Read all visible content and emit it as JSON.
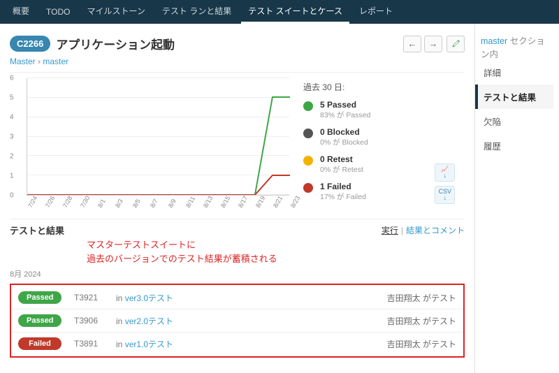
{
  "nav": {
    "tabs": [
      "概要",
      "TODO",
      "マイルストーン",
      "テスト ランと結果",
      "テスト スイートとケース",
      "レポート"
    ],
    "active": 4
  },
  "header": {
    "case_id": "C2266",
    "title": "アプリケーション起動"
  },
  "breadcrumb": {
    "a": "Master",
    "sep": "›",
    "b": "master"
  },
  "sidebar": {
    "master": "master",
    "master_suffix": "セクション内",
    "items": [
      "詳細",
      "テストと結果",
      "欠陥",
      "履歴"
    ],
    "active": 1
  },
  "chart_data": {
    "type": "line",
    "title": "過去 30 日:",
    "ylim": [
      0,
      6
    ],
    "yticks": [
      0,
      1,
      2,
      3,
      4,
      5,
      6
    ],
    "x": [
      "7/24",
      "7/26",
      "7/28",
      "7/30",
      "8/1",
      "8/3",
      "8/5",
      "8/7",
      "8/9",
      "8/11",
      "8/13",
      "8/15",
      "8/17",
      "8/19",
      "8/21",
      "8/23"
    ],
    "series": [
      {
        "name": "Passed",
        "color": "#3fa648",
        "values": [
          0,
          0,
          0,
          0,
          0,
          0,
          0,
          0,
          0,
          0,
          0,
          0,
          0,
          0,
          5,
          5
        ]
      },
      {
        "name": "Failed",
        "color": "#c0392b",
        "values": [
          0,
          0,
          0,
          0,
          0,
          0,
          0,
          0,
          0,
          0,
          0,
          0,
          0,
          0,
          1,
          1
        ]
      }
    ],
    "legend": [
      {
        "label": "5 Passed",
        "sub": "83% が Passed",
        "color": "#3fa648"
      },
      {
        "label": "0 Blocked",
        "sub": "0% が Blocked",
        "color": "#555"
      },
      {
        "label": "0 Retest",
        "sub": "0% が Retest",
        "color": "#f2b300"
      },
      {
        "label": "1 Failed",
        "sub": "17% が Failed",
        "color": "#c0392b"
      }
    ]
  },
  "stat_buttons": {
    "img": "📈",
    "csv": "CSV"
  },
  "section": {
    "title": "テストと結果",
    "run": "実行",
    "results_comments": "結果とコメント"
  },
  "annotation": {
    "l1": "マスターテストスイートに",
    "l2": "過去のバージョンでのテスト結果が蓄積される"
  },
  "month": "8月 2024",
  "results": [
    {
      "status": "Passed",
      "status_class": "pass",
      "tid": "T3921",
      "in": "in ",
      "run": "ver3.0テスト",
      "tester": "吉田翔太 がテスト"
    },
    {
      "status": "Passed",
      "status_class": "pass",
      "tid": "T3906",
      "in": "in ",
      "run": "ver2.0テスト",
      "tester": "吉田翔太 がテスト"
    },
    {
      "status": "Failed",
      "status_class": "fail",
      "tid": "T3891",
      "in": "in ",
      "run": "ver1.0テスト",
      "tester": "吉田翔太 がテスト"
    }
  ]
}
